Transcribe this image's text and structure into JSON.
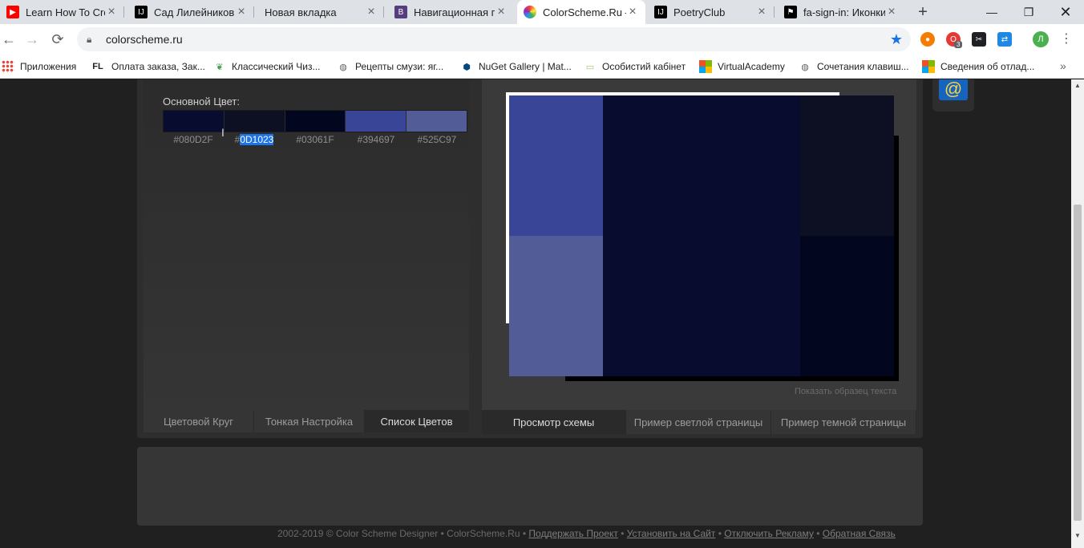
{
  "tabs": [
    {
      "title": "Learn How To Crea",
      "fav_color": "#ff0000",
      "fav_glyph": "▶"
    },
    {
      "title": "Сад Лилейников",
      "fav_color": "#000000",
      "fav_glyph": "IJ"
    },
    {
      "title": "Новая вкладка",
      "fav_color": "",
      "fav_glyph": ""
    },
    {
      "title": "Навигационная п",
      "fav_color": "#563d7c",
      "fav_glyph": "B"
    },
    {
      "title": "ColorScheme.Ru –",
      "fav_color": "#e040fb",
      "fav_glyph": "●"
    },
    {
      "title": "PoetryClub",
      "fav_color": "#000000",
      "fav_glyph": "IJ"
    },
    {
      "title": "fa-sign-in: Иконки",
      "fav_color": "#000000",
      "fav_glyph": "⚑"
    }
  ],
  "address": {
    "url": "colorscheme.ru"
  },
  "extensions": {
    "badge": "3"
  },
  "profile": {
    "initial": "Л"
  },
  "bookmarks": [
    {
      "label": "Приложения",
      "icon": "apps-icon"
    },
    {
      "label": "Оплата заказа, Зак...",
      "icon": "fl-icon",
      "glyph": "FL"
    },
    {
      "label": "Классический Чиз...",
      "icon": "leaf-icon"
    },
    {
      "label": "Рецепты смузи: яг...",
      "icon": "globe-icon"
    },
    {
      "label": "NuGet Gallery | Mat...",
      "icon": "nuget-icon"
    },
    {
      "label": "Особистий кабінет",
      "icon": "card-icon"
    },
    {
      "label": "VirtualAcademy",
      "icon": "windows-icon"
    },
    {
      "label": "Сочетания клавиш...",
      "icon": "globe-icon"
    },
    {
      "label": "Сведения об отлад...",
      "icon": "windows-icon"
    }
  ],
  "scheme": {
    "base_label": "Основной Цвет:",
    "colors": [
      "#080D2F",
      "#0D1023",
      "#03061F",
      "#394697",
      "#525C97"
    ],
    "code_prefix": "#",
    "selected_code": "0D1023"
  },
  "preview": {
    "show_text": "Показать образец текста"
  },
  "left_tabs": [
    "Цветовой Круг",
    "Тонкая Настройка",
    "Список Цветов"
  ],
  "right_tabs": [
    "Просмотр схемы",
    "Пример светлой страницы",
    "Пример темной страницы"
  ],
  "footer": {
    "copyright": "2002-2019 © Color Scheme Designer • ColorScheme.Ru •",
    "link1": "Поддержать Проект",
    "link2": "Установить на Сайт",
    "link3": "Отключить Рекламу",
    "link4": "Обратная Связь",
    "sep": "•"
  },
  "widget": {
    "symbol": "@"
  }
}
